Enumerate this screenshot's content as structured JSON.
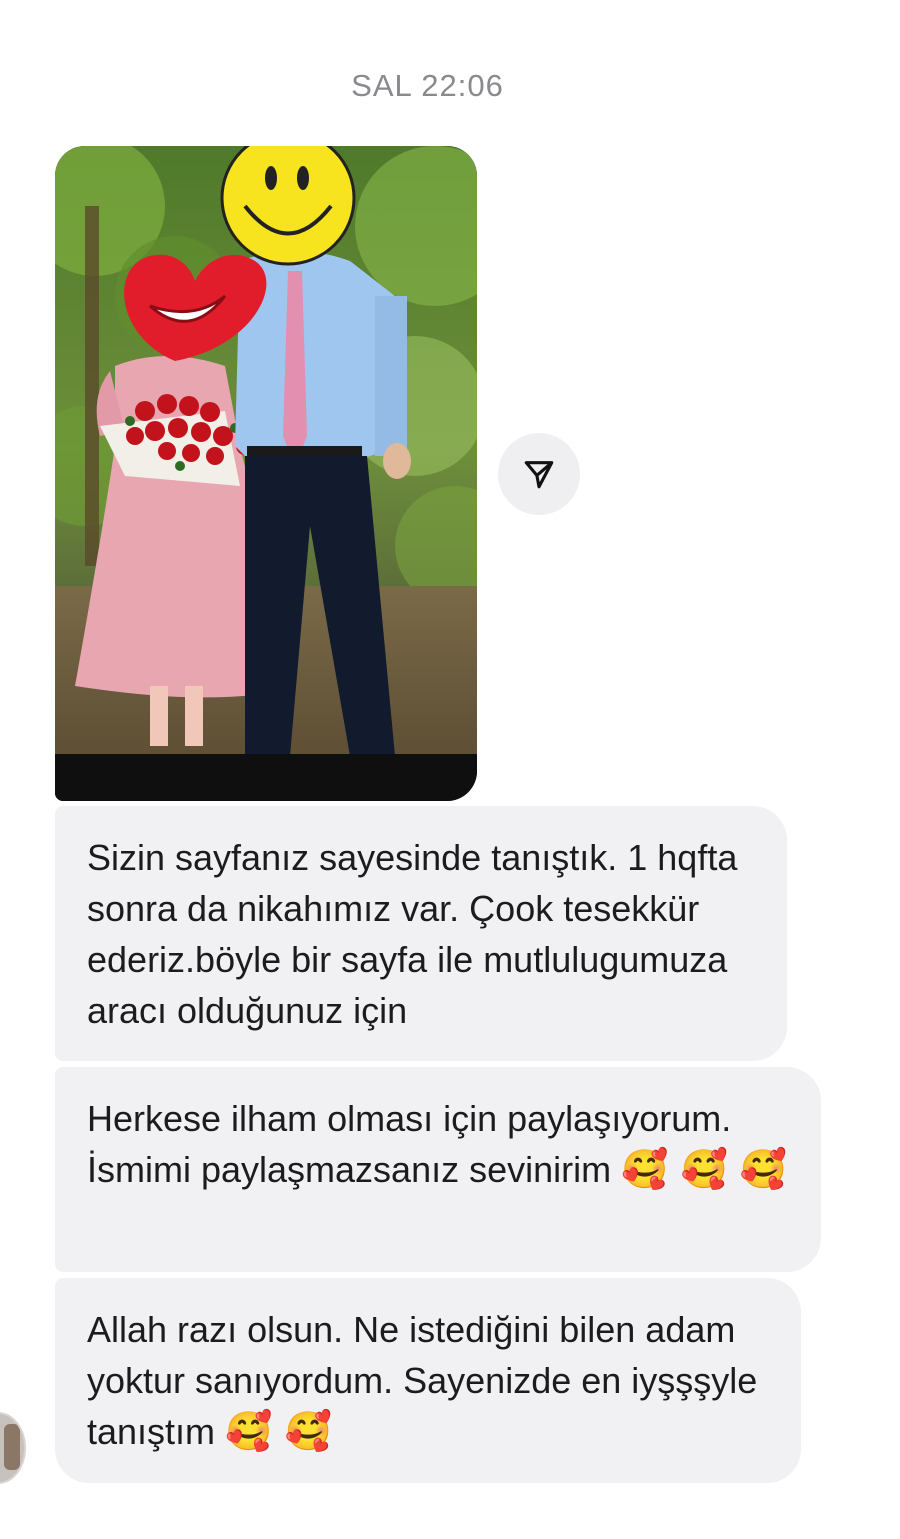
{
  "header": {
    "timestamp": "SAL 22:06"
  },
  "photo_message": {
    "icon": "photo-attachment"
  },
  "share_button": {
    "icon": "send-icon"
  },
  "messages": [
    {
      "text": "Sizin sayfanız sayesinde tanıştık. 1 hqfta sonra da nikahımız var. Çook tesekkür ederiz.böyle bir sayfa ile mutlulugumuza aracı olduğunuz için"
    },
    {
      "text": "Herkese ilham olması için paylaşıyorum. İsmimi paylaşmazsanız sevinirim",
      "emoji": "🥰 🥰 🥰"
    },
    {
      "text": "Allah razı olsun. Ne istediğini bilen adam yoktur sanıyordum. Sayenizde en iyşşşyle tanıştım",
      "emoji": "🥰 🥰"
    }
  ],
  "colors": {
    "bubble_bg": "#f1f1f4",
    "timestamp": "#8a8a8e",
    "share_bg": "#efeff2"
  }
}
